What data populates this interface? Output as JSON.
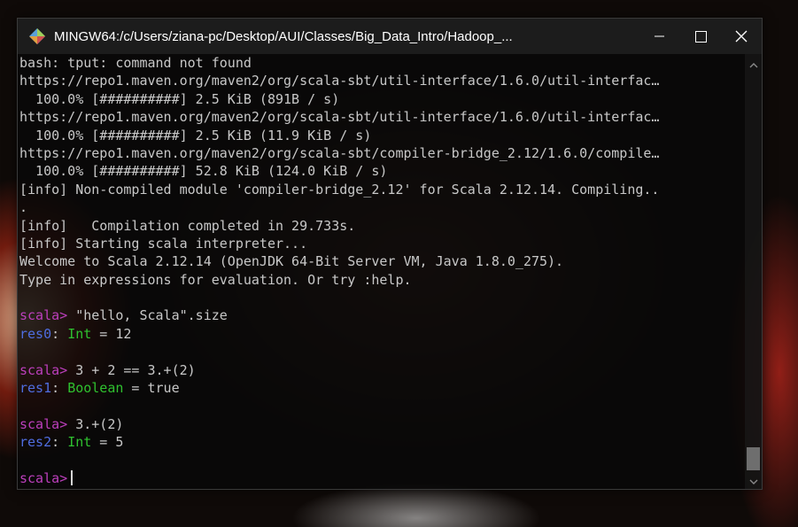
{
  "window": {
    "title": "MINGW64:/c/Users/ziana-pc/Desktop/AUI/Classes/Big_Data_Intro/Hadoop_..."
  },
  "icons": {
    "app": "mingw-diamond-icon",
    "minimize": "minimize-icon",
    "maximize": "maximize-icon",
    "close": "close-icon",
    "scroll_up": "chevron-up-icon",
    "scroll_down": "chevron-down-icon"
  },
  "colors": {
    "prompt": "#bc3fbc",
    "result_name": "#4f6de0",
    "type": "#2fc12f",
    "text": "#c8c8c8"
  },
  "terminal": {
    "l1": "bash: tput: command not found",
    "l2": "https://repo1.maven.org/maven2/org/scala-sbt/util-interface/1.6.0/util-interfac…",
    "l3": "  100.0% [##########] 2.5 KiB (891B / s)",
    "l4": "https://repo1.maven.org/maven2/org/scala-sbt/util-interface/1.6.0/util-interfac…",
    "l5": "  100.0% [##########] 2.5 KiB (11.9 KiB / s)",
    "l6": "https://repo1.maven.org/maven2/org/scala-sbt/compiler-bridge_2.12/1.6.0/compile…",
    "l7": "  100.0% [##########] 52.8 KiB (124.0 KiB / s)",
    "l8": "[info] Non-compiled module 'compiler-bridge_2.12' for Scala 2.12.14. Compiling..",
    "l9": ".",
    "l10": "[info]   Compilation completed in 29.733s.",
    "l11": "[info] Starting scala interpreter...",
    "l12": "Welcome to Scala 2.12.14 (OpenJDK 64-Bit Server VM, Java 1.8.0_275).",
    "l13": "Type in expressions for evaluation. Or try :help.",
    "prompt": "scala>",
    "cmd1": " \"hello, Scala\".size",
    "res0_name": "res0",
    "res0_type": "Int",
    "res0_value": " = 12",
    "cmd2": " 3 + 2 == 3.+(2)",
    "res1_name": "res1",
    "res1_type": "Boolean",
    "res1_value": " = true",
    "cmd3": " 3.+(2)",
    "res2_name": "res2",
    "res2_type": "Int",
    "res2_value": " = 5",
    "colon": ": "
  }
}
